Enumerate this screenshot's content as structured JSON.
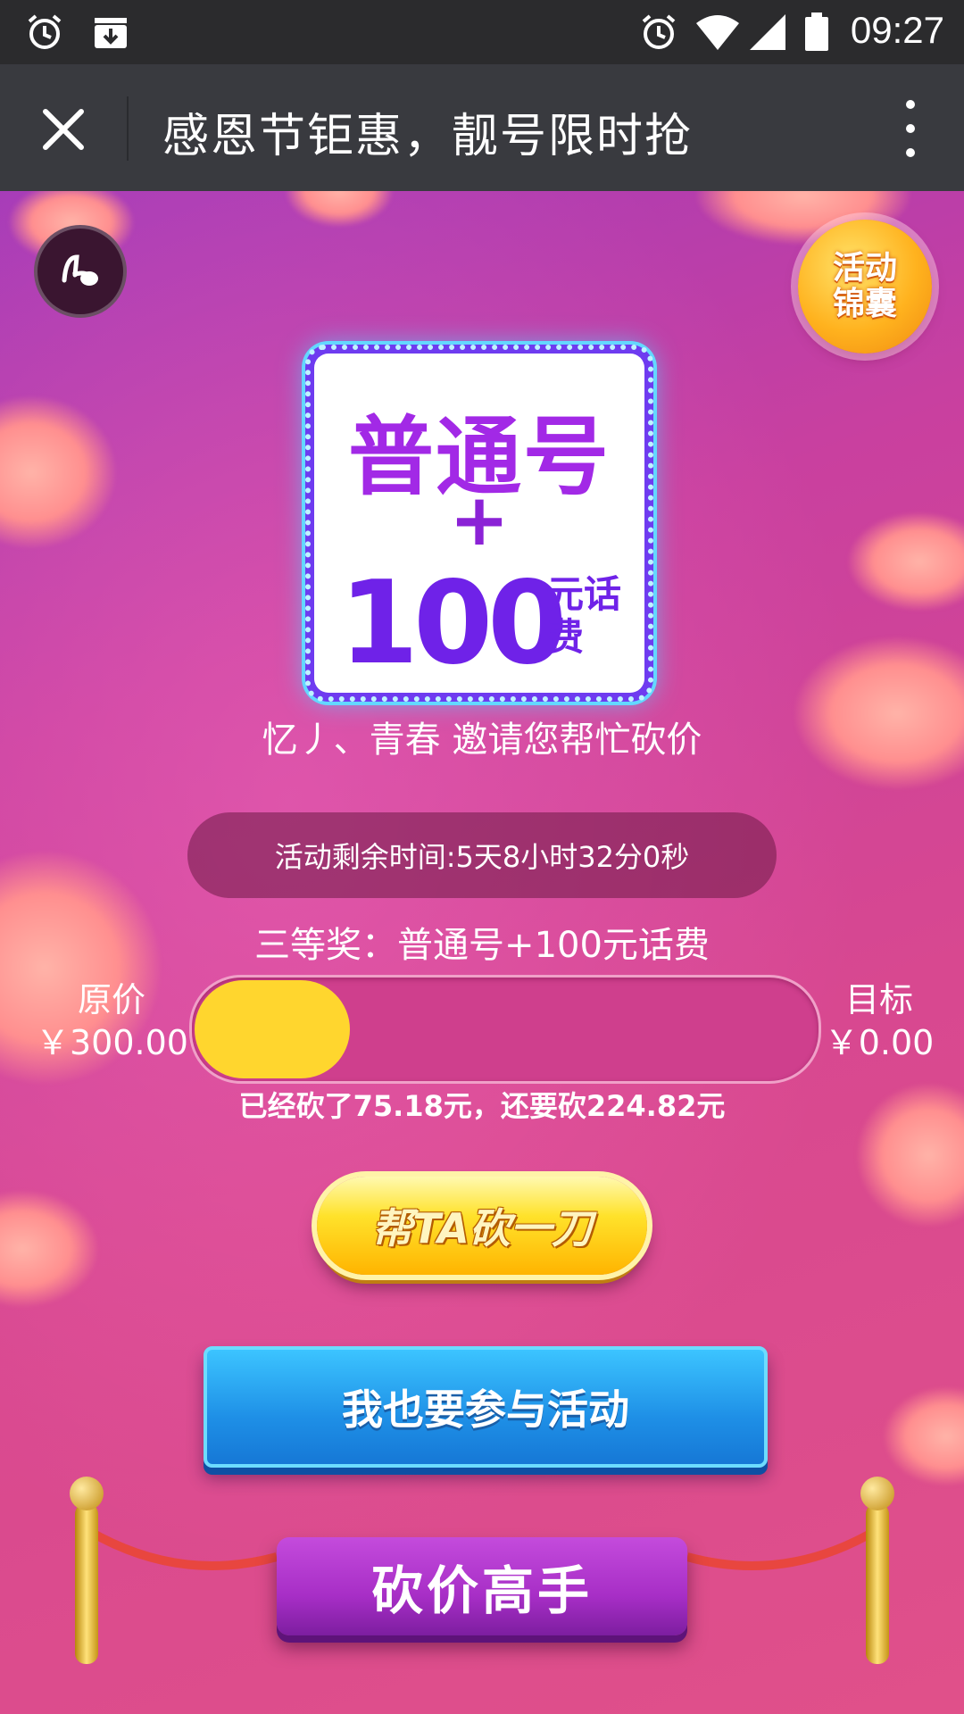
{
  "status_bar": {
    "time": "09:27",
    "icons": [
      "alarm-icon",
      "download-icon",
      "alarm-icon",
      "wifi-icon",
      "signal-icon",
      "battery-icon"
    ]
  },
  "title_bar": {
    "title": "感恩节钜惠，靓号限时抢"
  },
  "floating": {
    "tips_label": "活动锦囊"
  },
  "prize_card": {
    "line1": "普通号",
    "plus": "+",
    "amount": "100",
    "unit": "元话费"
  },
  "invite_text": "忆丿、青春 邀请您帮忙砍价",
  "countdown_text": "活动剩余时间:5天8小时32分0秒",
  "prize_level": "三等奖：普通号+100元话费",
  "price": {
    "original_label": "原价",
    "original_value": "￥300.00",
    "target_label": "目标",
    "target_value": "￥0.00",
    "progress_fraction": 0.2506
  },
  "cut_status": "已经砍了75.18元，还要砍224.82元",
  "buttons": {
    "help_cut": "帮TA砍一刀",
    "join": "我也要参与活动"
  },
  "leaderboard_banner": "砍价高手",
  "colors": {
    "progress_fill": "#ffd62e",
    "join_button": "#1e8fe6",
    "help_button": "#ffe22b"
  }
}
